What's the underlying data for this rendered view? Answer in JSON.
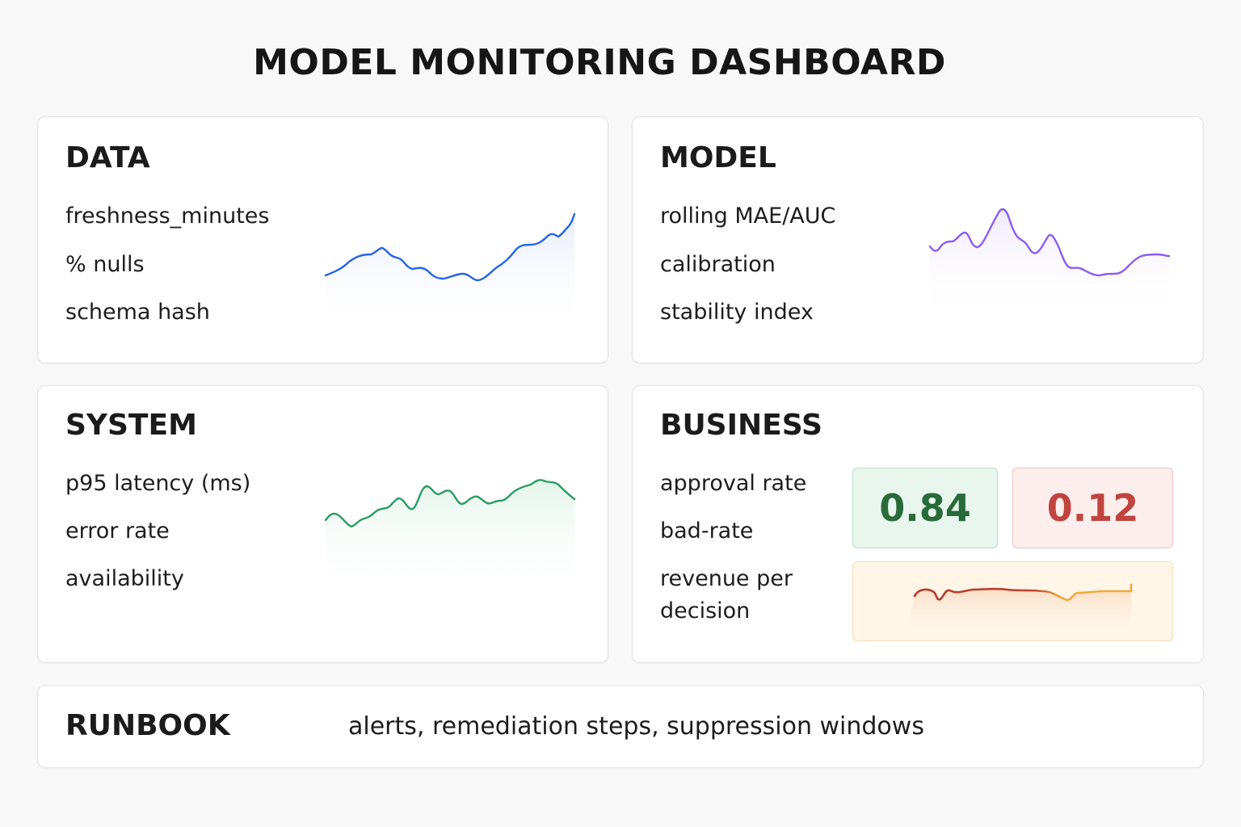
{
  "title": "MODEL MONITORING DASHBOARD",
  "data_panel": {
    "title": "DATA",
    "metrics": [
      "freshness_minutes",
      "% nulls",
      "schema hash"
    ],
    "sparkline": {
      "color": "#2563eb",
      "fill": "#e7ebfb"
    }
  },
  "model_panel": {
    "title": "MODEL",
    "metrics": [
      "rolling MAE/AUC",
      "calibration",
      "stability index"
    ],
    "sparkline": {
      "color": "#8b5cf6",
      "fill": "#efe9fd"
    }
  },
  "system_panel": {
    "title": "SYSTEM",
    "metrics": [
      "p95 latency (ms)",
      "error rate",
      "availability"
    ],
    "sparkline": {
      "color": "#2a9d61",
      "fill": "#e3f4ea"
    }
  },
  "business_panel": {
    "title": "BUSINESS",
    "metrics": [
      "approval rate",
      "bad-rate",
      "revenue per decision"
    ],
    "approval_rate_value": "0.84",
    "bad_rate_value": "0.12",
    "colors": {
      "approval_text": "#276b38",
      "approval_bg": "#e9f6ee",
      "bad_text": "#c0443d",
      "bad_bg": "#fdeeee",
      "revenue_line_start": "#b23a2a",
      "revenue_line_end": "#f0a93a",
      "revenue_bg": "#fff6e8"
    }
  },
  "runbook": {
    "title": "RUNBOOK",
    "text": "alerts, remediation steps, suppression windows"
  }
}
